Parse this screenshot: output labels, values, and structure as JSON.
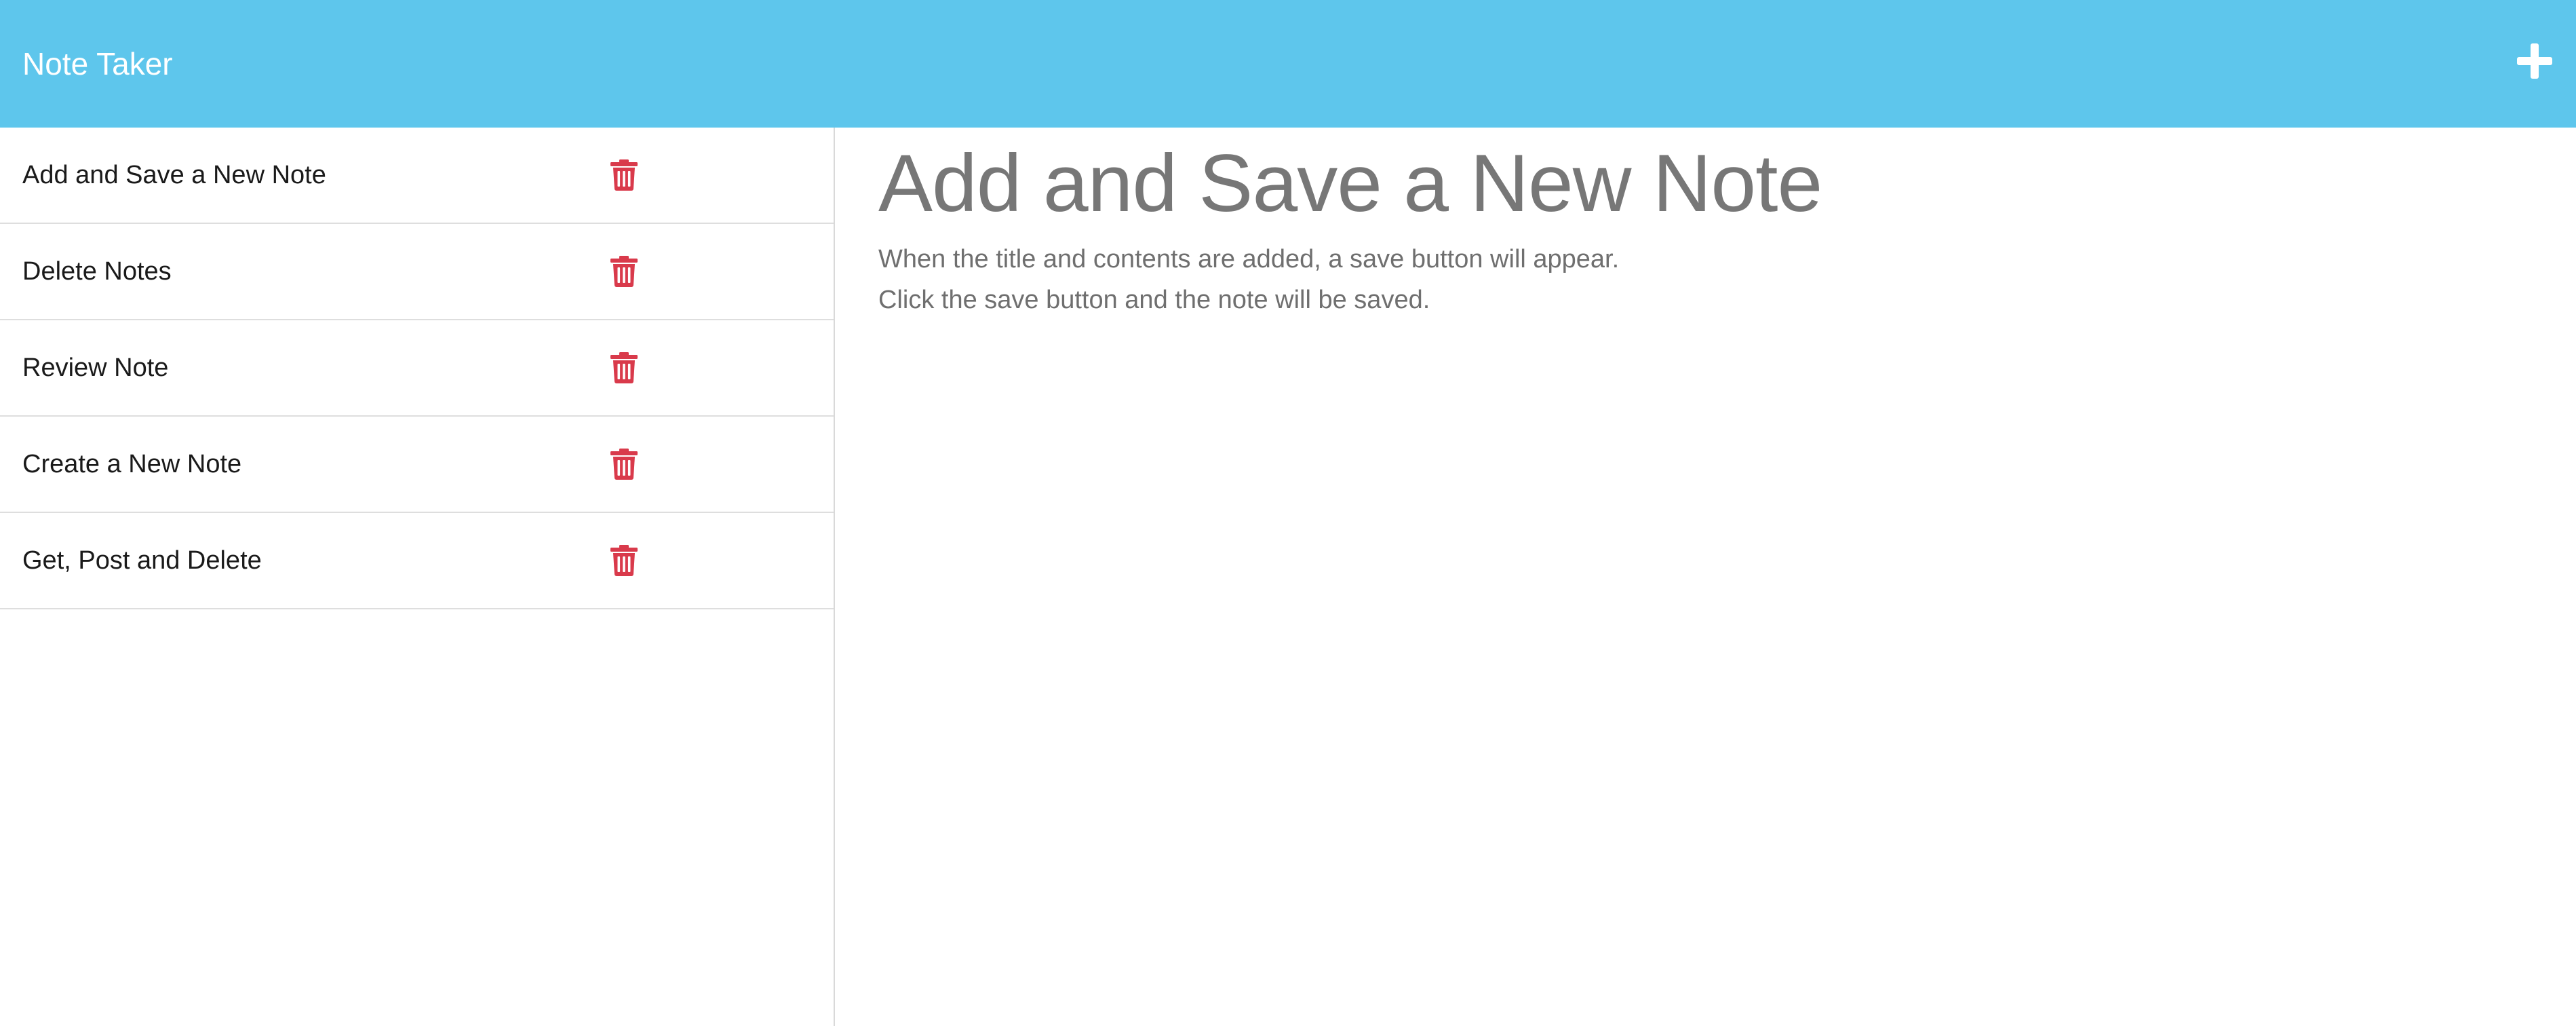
{
  "app": {
    "title": "Note Taker"
  },
  "header": {
    "new_note_icon": "plus-icon"
  },
  "colors": {
    "navbar": "#5ec6ec",
    "delete": "#d93a4b",
    "title_text": "#777777"
  },
  "notes": [
    {
      "title": "Add and Save a New Note",
      "icon": "trash-icon"
    },
    {
      "title": "Delete Notes",
      "icon": "trash-icon"
    },
    {
      "title": "Review Note",
      "icon": "trash-icon"
    },
    {
      "title": "Create a New Note",
      "icon": "trash-icon"
    },
    {
      "title": "Get, Post and Delete",
      "icon": "trash-icon"
    }
  ],
  "main": {
    "heading": "Add and Save a New Note",
    "line1": "When the title and contents are added, a save button will appear.",
    "line2": "Click the save button and the note will be saved."
  }
}
